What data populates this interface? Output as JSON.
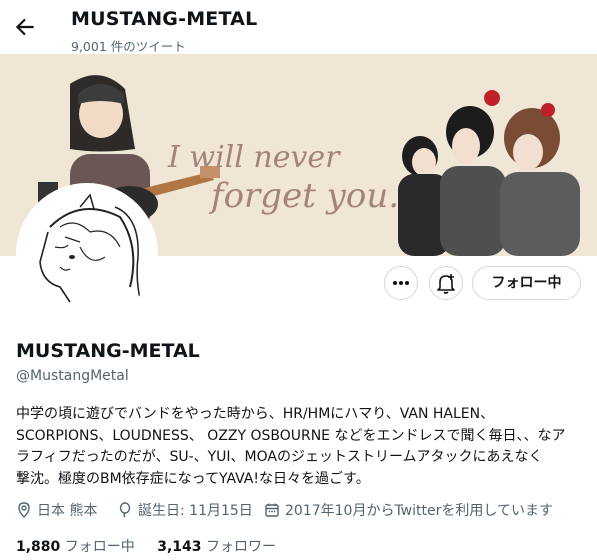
{
  "header": {
    "title": "MUSTANG-METAL",
    "tweet_count": "9,001 件のツイート"
  },
  "banner": {
    "line1": "I will never",
    "line2": "forget you."
  },
  "actions": {
    "follow_label": "フォロー中"
  },
  "profile": {
    "name": "MUSTANG-METAL",
    "handle": "@MustangMetal",
    "bio_lines": [
      "中学の頃に遊びでバンドをやった時から、HR/HMにハマり、VAN HALEN、",
      "SCORPIONS、LOUDNESS、 OZZY OSBOURNE などをエンドレスで聞く毎日、、なア",
      "ラフィフだったのだが、SU-、YUI、MOAのジェットストリームアタックにあえなく",
      "撃沈。極度のBM依存症になってYAVA!な日々を過ごす。"
    ],
    "location": "日本 熊本",
    "birthday": "誕生日: 11月15日",
    "joined": "2017年10月からTwitterを利用しています"
  },
  "stats": {
    "following_count": "1,880",
    "following_label": "フォロー中",
    "followers_count": "3,143",
    "followers_label": "フォロワー"
  },
  "icons": [
    "back-arrow-icon",
    "more-icon",
    "notification-bell-icon",
    "location-icon",
    "balloon-icon",
    "calendar-icon"
  ],
  "colors": {
    "text": "#0f1419",
    "secondary": "#536471",
    "border": "#cfd9de",
    "banner_bg": "#efe6d5",
    "banner_text": "#a6827c"
  }
}
